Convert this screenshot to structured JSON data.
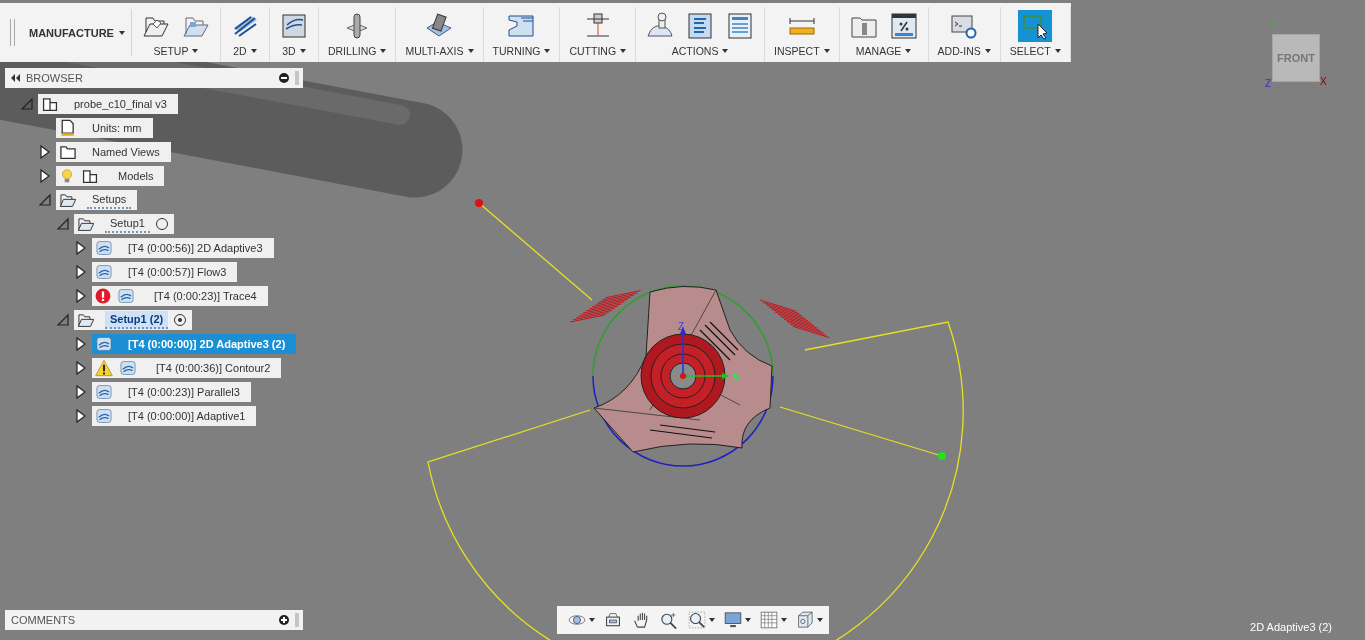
{
  "toolbar": {
    "workspace": "MANUFACTURE",
    "groups": [
      {
        "label": "SETUP",
        "active": false
      },
      {
        "label": "2D",
        "active": false
      },
      {
        "label": "3D",
        "active": false
      },
      {
        "label": "DRILLING",
        "active": false
      },
      {
        "label": "MULTI-AXIS",
        "active": false
      },
      {
        "label": "TURNING",
        "active": false
      },
      {
        "label": "CUTTING",
        "active": false
      },
      {
        "label": "ACTIONS",
        "active": false
      },
      {
        "label": "INSPECT",
        "active": false
      },
      {
        "label": "MANAGE",
        "active": false
      },
      {
        "label": "ADD-INS",
        "active": false
      },
      {
        "label": "SELECT",
        "active": true
      }
    ]
  },
  "browser": {
    "title": "BROWSER",
    "tree": [
      {
        "kind": "document",
        "label": "probe_c10_final v3",
        "expanded": true,
        "selected": false,
        "children": [
          {
            "kind": "units",
            "label": "Units: mm",
            "selected": false
          },
          {
            "kind": "folder",
            "label": "Named Views",
            "expanded": false,
            "selected": false
          },
          {
            "kind": "models",
            "label": "Models",
            "expanded": false,
            "selected": false
          },
          {
            "kind": "setups",
            "label": "Setups",
            "expanded": true,
            "selected": false,
            "children": [
              {
                "kind": "setup",
                "label": "Setup1",
                "expanded": true,
                "active": false,
                "selected": false,
                "children": [
                  {
                    "kind": "operation",
                    "label": "[T4 (0:00:56)] 2D Adaptive3",
                    "expanded": false,
                    "error": false,
                    "warning": false,
                    "selected": false
                  },
                  {
                    "kind": "operation",
                    "label": "[T4 (0:00:57)] Flow3",
                    "expanded": false,
                    "error": false,
                    "warning": false,
                    "selected": false
                  },
                  {
                    "kind": "operation",
                    "label": "[T4 (0:00:23)] Trace4",
                    "expanded": false,
                    "error": true,
                    "warning": false,
                    "selected": false
                  }
                ]
              },
              {
                "kind": "setup",
                "label": "Setup1 (2)",
                "expanded": true,
                "active": true,
                "selected": false,
                "children": [
                  {
                    "kind": "operation",
                    "label": "[T4 (0:00:00)] 2D Adaptive3 (2)",
                    "expanded": false,
                    "error": false,
                    "warning": false,
                    "selected": true
                  },
                  {
                    "kind": "operation",
                    "label": "[T4 (0:00:36)] Contour2",
                    "expanded": false,
                    "error": false,
                    "warning": true,
                    "selected": false
                  },
                  {
                    "kind": "operation",
                    "label": "[T4 (0:00:23)] Parallel3",
                    "expanded": false,
                    "error": false,
                    "warning": false,
                    "selected": false
                  },
                  {
                    "kind": "operation",
                    "label": "[T4 (0:00:00)] Adaptive1",
                    "expanded": false,
                    "error": false,
                    "warning": false,
                    "selected": false
                  }
                ]
              }
            ]
          }
        ]
      }
    ]
  },
  "comments": {
    "title": "COMMENTS"
  },
  "status": "2D Adaptive3 (2)",
  "viewcube": {
    "face": "FRONT",
    "axes": [
      "Y",
      "Z",
      "X"
    ]
  },
  "scene": {
    "axes": [
      "Z",
      "Y"
    ]
  }
}
